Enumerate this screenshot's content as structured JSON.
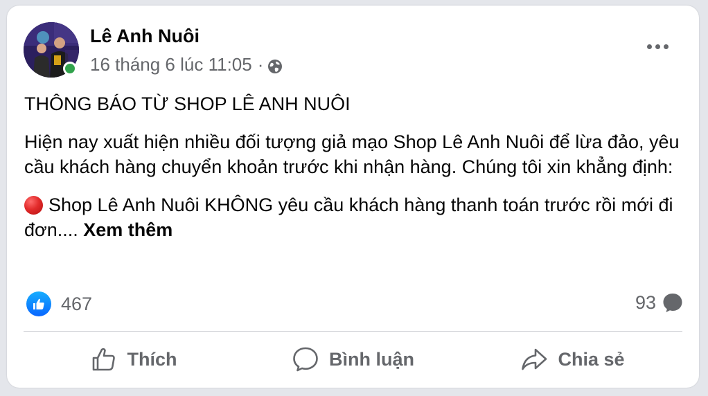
{
  "post": {
    "author": "Lê Anh Nuôi",
    "timestamp": "16 tháng 6 lúc 11:05",
    "separator": "·",
    "privacy_icon": "globe-icon",
    "online_status": "online",
    "title": "THÔNG BÁO TỪ SHOP LÊ ANH NUÔI",
    "paragraph1": "Hiện nay xuất hiện nhiều đối tượng giả mạo Shop Lê Anh Nuôi để lừa đảo, yêu cầu khách hàng chuyển khoản trước khi nhận hàng. Chúng tôi xin khẳng định:",
    "paragraph2": "Shop Lê Anh Nuôi KHÔNG yêu cầu khách hàng thanh toán trước rồi mới đi đơn....",
    "see_more": "Xem thêm"
  },
  "stats": {
    "likes": "467",
    "comments": "93"
  },
  "actions": {
    "like": "Thích",
    "comment": "Bình luận",
    "share": "Chia sẻ"
  },
  "colors": {
    "accent_blue": "#0866ff",
    "online_green": "#31a24c",
    "secondary_text": "#65676b",
    "red_circle": "#e22b2b"
  }
}
